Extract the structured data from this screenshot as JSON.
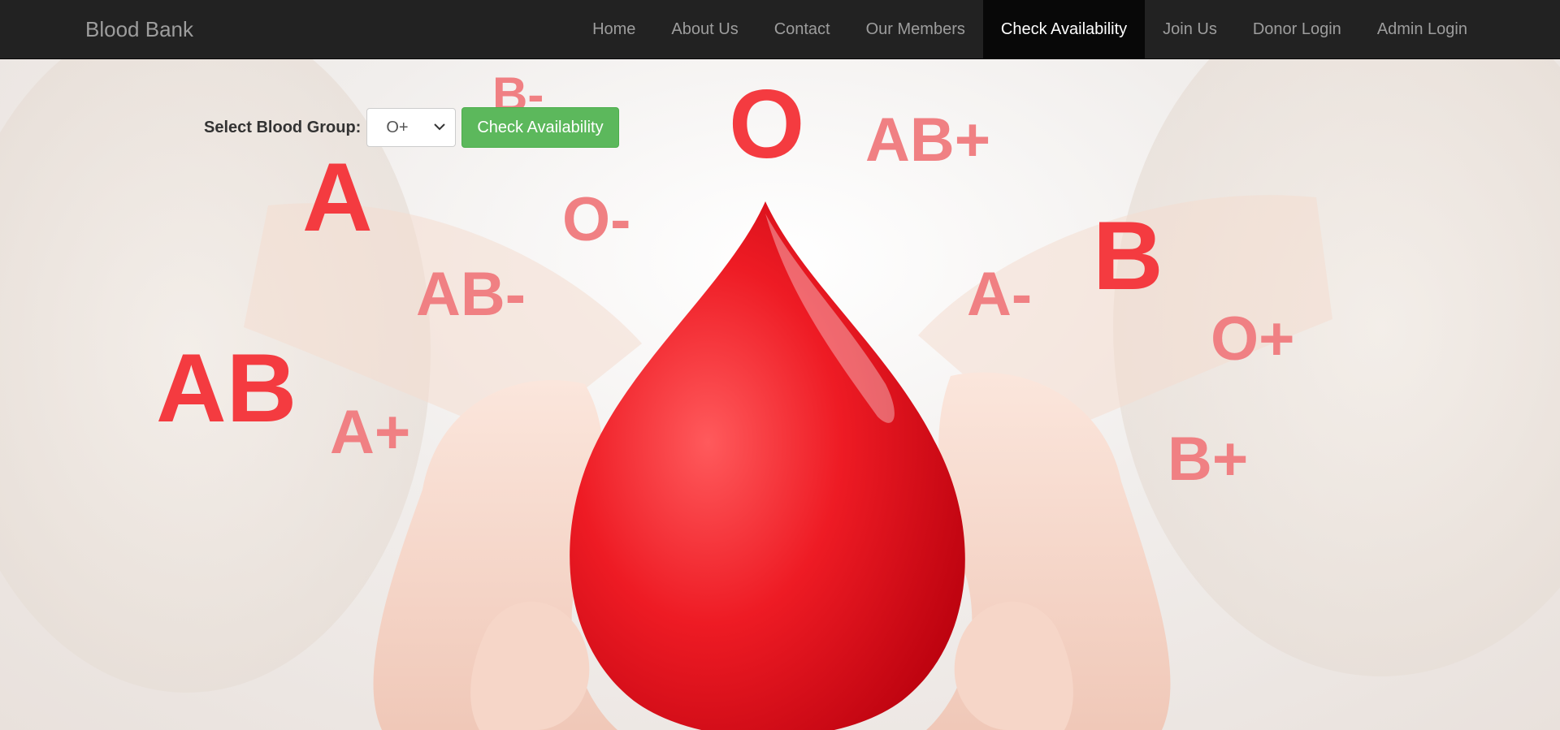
{
  "brand": "Blood Bank",
  "nav": {
    "items": [
      "Home",
      "About Us",
      "Contact",
      "Our Members",
      "Check Availability",
      "Join Us",
      "Donor Login",
      "Admin Login"
    ],
    "active": "Check Availability"
  },
  "form": {
    "label": "Select Blood Group:",
    "selected": "O+",
    "button_label": "Check Availability"
  },
  "hero_labels": {
    "b_neg": "B-",
    "o": "O",
    "ab_pos": "AB+",
    "a": "A",
    "o_neg": "O-",
    "b": "B",
    "ab_neg": "AB-",
    "a_neg": "A-",
    "o_pos": "O+",
    "ab": "AB",
    "a_pos": "A+",
    "b_pos": "B+"
  },
  "colors": {
    "navbar": "#222222",
    "active_tab": "#080808",
    "button": "#5cb85c",
    "blood": "#e8101c"
  },
  "icons": {
    "select_arrow": "chevron-down-icon",
    "hero": "blood-drop-icon"
  }
}
